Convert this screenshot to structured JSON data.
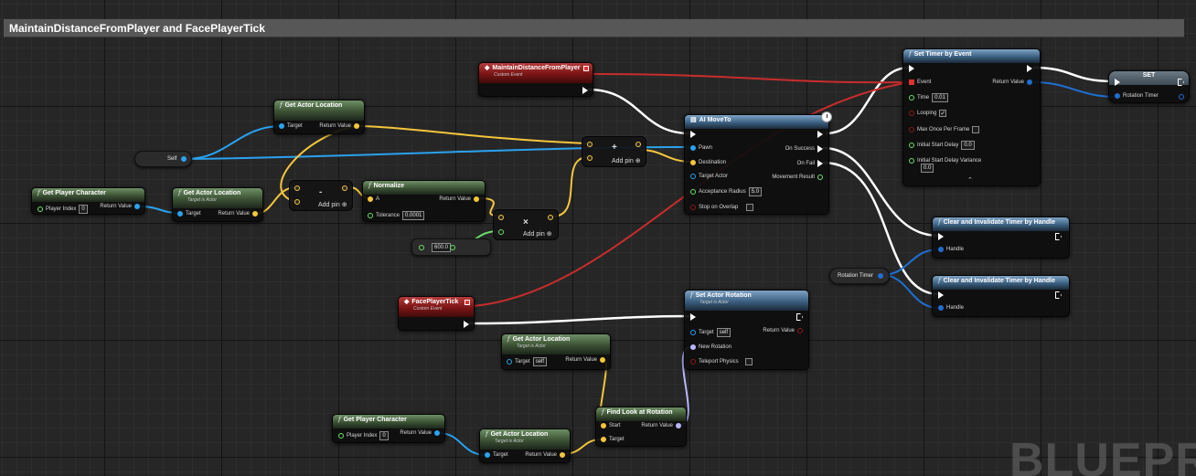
{
  "comment": {
    "title": "MaintainDistanceFromPlayer and FacePlayerTick"
  },
  "colors": {
    "exec": "#ffffff",
    "object": "#2aa2f0",
    "vector": "#f5c63c",
    "float": "#6de06a",
    "event": "#d22c2c",
    "rotator": "#b7b7ff",
    "handle": "#1f6fd0"
  },
  "watermark": "BLUEPR",
  "nodes": {
    "self_var": {
      "label": "Self"
    },
    "get_player_character_1": {
      "title": "Get Player Character",
      "pin_player_index": "Player Index",
      "player_index_value": "0",
      "pin_return": "Return Value"
    },
    "get_actor_location_1": {
      "title": "Get Actor Location",
      "subtitle": "Target is Actor",
      "pin_target": "Target",
      "pin_return": "Return Value"
    },
    "get_actor_location_top": {
      "title": "Get Actor Location",
      "pin_target": "Target",
      "pin_return": "Return Value"
    },
    "subtract": {
      "symbol": "-",
      "add_pin": "Add pin"
    },
    "normalize": {
      "title": "Normalize",
      "pin_a": "A",
      "pin_tolerance": "Tolerance",
      "tolerance_value": "0.0001",
      "pin_return": "Return Value"
    },
    "multiply": {
      "symbol": "×",
      "add_pin": "Add pin"
    },
    "float_literal": {
      "value": "600.0"
    },
    "add": {
      "symbol": "+",
      "add_pin": "Add pin"
    },
    "event_maintain": {
      "title": "MaintainDistanceFromPlayer",
      "subtitle": "Custom Event"
    },
    "ai_move_to": {
      "title": "AI MoveTo",
      "pin_pawn": "Pawn",
      "pin_destination": "Destination",
      "pin_target_actor": "Target Actor",
      "pin_acceptance_radius": "Acceptance Radius",
      "acceptance_radius_value": "5.0",
      "pin_stop_on_overlap": "Stop on Overlap",
      "pin_on_success": "On Success",
      "pin_on_fail": "On Fail",
      "pin_movement_result": "Movement Result"
    },
    "set_timer": {
      "title": "Set Timer by Event",
      "pin_event": "Event",
      "pin_time": "Time",
      "time_value": "0.01",
      "pin_looping": "Looping",
      "looping_checked": "✓",
      "pin_max_once": "Max Once Per Frame",
      "pin_initial_delay": "Initial Start Delay",
      "initial_delay_value": "0.0",
      "pin_initial_variance": "Initial Start Delay Variance",
      "initial_variance_value": "0.0",
      "pin_return": "Return Value",
      "collapse": "⌃"
    },
    "set_var": {
      "title": "SET",
      "pin_rotation_timer": "Rotation Timer"
    },
    "clear_timer_1": {
      "title": "Clear and Invalidate Timer by Handle",
      "pin_handle": "Handle"
    },
    "clear_timer_2": {
      "title": "Clear and Invalidate Timer by Handle",
      "pin_handle": "Handle"
    },
    "rotation_timer_var": {
      "label": "Rotation Timer"
    },
    "event_face": {
      "title": "FacePlayerTick",
      "subtitle": "Custom Event"
    },
    "set_actor_rotation": {
      "title": "Set Actor Rotation",
      "subtitle": "Target is Actor",
      "pin_target": "Target",
      "target_value": "self",
      "pin_new_rotation": "New Rotation",
      "pin_teleport": "Teleport Physics",
      "pin_return": "Return Value"
    },
    "get_actor_location_2": {
      "title": "Get Actor Location",
      "subtitle": "Target is Actor",
      "pin_target": "Target",
      "target_value": "self",
      "pin_return": "Return Value"
    },
    "get_player_character_2": {
      "title": "Get Player Character",
      "pin_player_index": "Player Index",
      "player_index_value": "0",
      "pin_return": "Return Value"
    },
    "get_actor_location_3": {
      "title": "Get Actor Location",
      "subtitle": "Target is Actor",
      "pin_target": "Target",
      "pin_return": "Return Value"
    },
    "find_look_at": {
      "title": "Find Look at Rotation",
      "pin_start": "Start",
      "pin_target": "Target",
      "pin_return": "Return Value"
    }
  }
}
